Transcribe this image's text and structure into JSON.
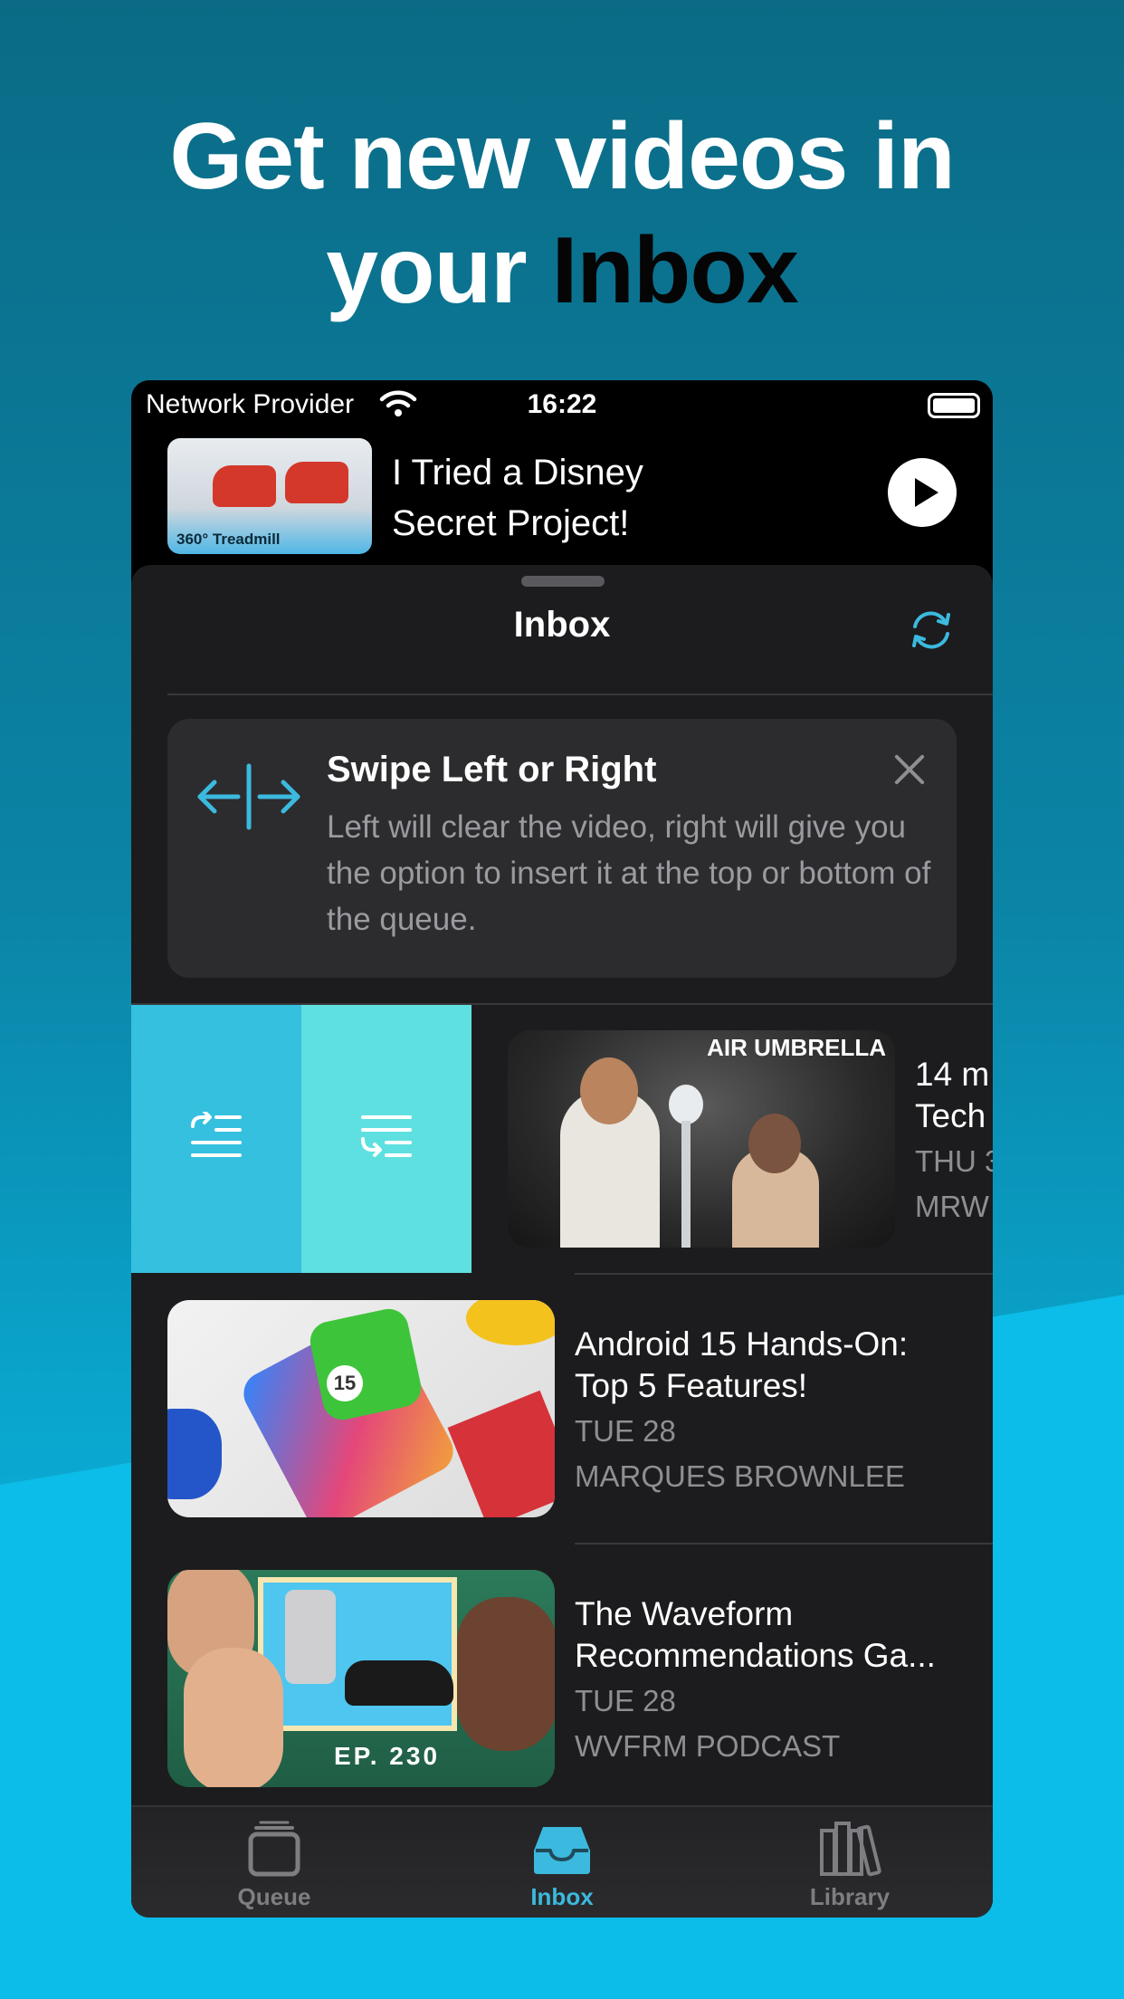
{
  "headline": {
    "line1": "Get new videos in",
    "line2_prefix": "your ",
    "line2_highlight": "Inbox"
  },
  "status_bar": {
    "carrier": "Network Provider",
    "time": "16:22"
  },
  "now_playing": {
    "title": "I Tried a Disney Secret Project!",
    "thumb_label": "360° Treadmill"
  },
  "sheet": {
    "title": "Inbox"
  },
  "tip": {
    "title": "Swipe Left or Right",
    "body": "Left will clear the video, right will give you the option to insert it at the top or bottom of the queue."
  },
  "videos": [
    {
      "title_line1": "14 m",
      "title_line2": "Tech",
      "date": "THU 3",
      "channel": "MRW",
      "thumb_text": "AIR UMBRELLA"
    },
    {
      "title_line1": "Android 15 Hands-On:",
      "title_line2": "Top 5 Features!",
      "date": "TUE 28",
      "channel": "MARQUES BROWNLEE",
      "thumb_text": "15"
    },
    {
      "title_line1": "The Waveform",
      "title_line2": "Recommendations Ga...",
      "date": "TUE 28",
      "channel": "WVFRM PODCAST",
      "thumb_text": "EP. 230"
    }
  ],
  "tabs": [
    {
      "label": "Queue",
      "icon": "queue-icon"
    },
    {
      "label": "Inbox",
      "icon": "inbox-tray-icon"
    },
    {
      "label": "Library",
      "icon": "library-books-icon"
    }
  ],
  "colors": {
    "accent": "#3cb9de",
    "swipe_top": "#35c0e0",
    "swipe_bottom": "#5fe0e0"
  }
}
